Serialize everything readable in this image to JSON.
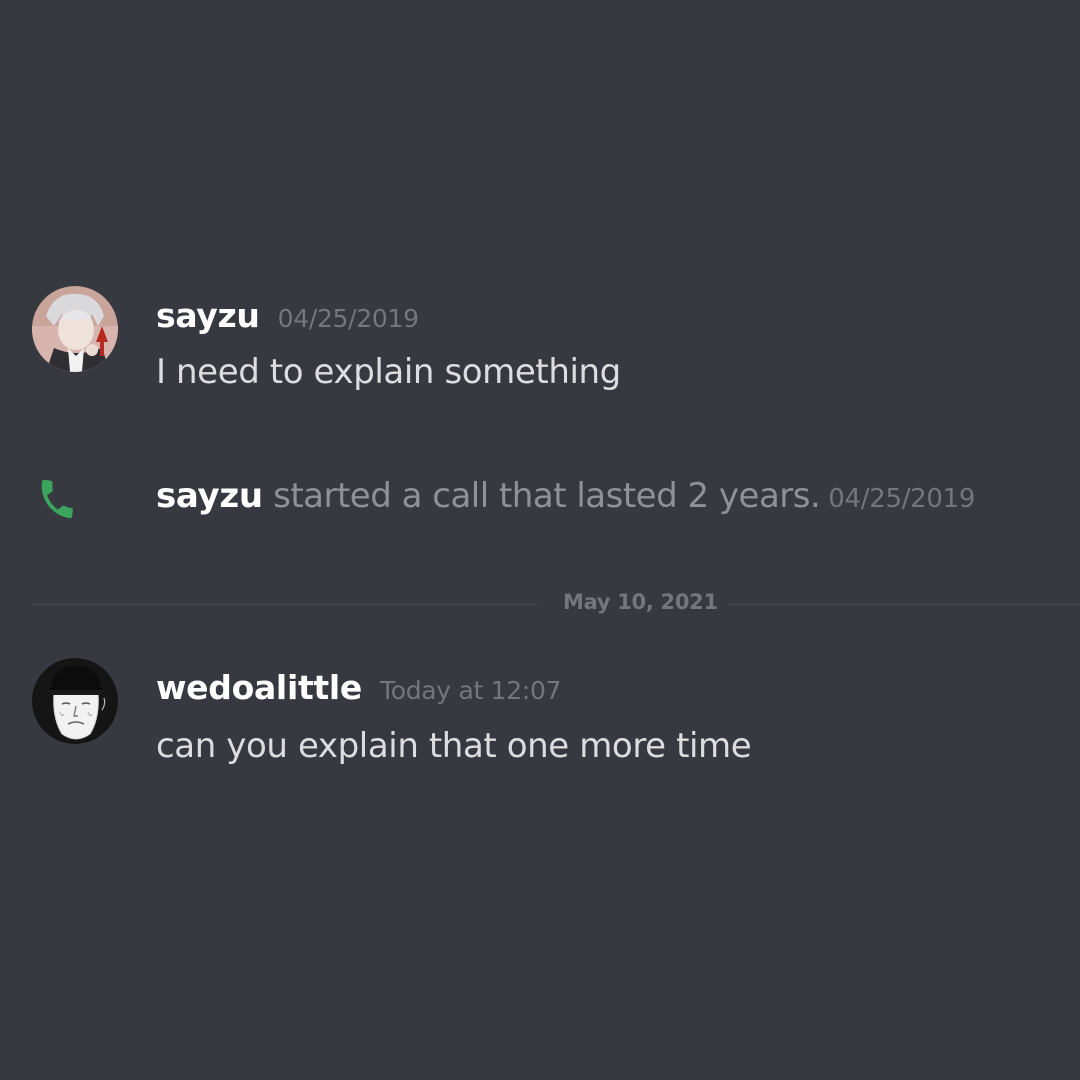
{
  "colors": {
    "background": "#36393f",
    "username": "#ffffff",
    "timestamp": "#72767d",
    "message_text": "#dcddde",
    "system_text": "#8e9297",
    "call_icon": "#3ba55d"
  },
  "messages": [
    {
      "username": "sayzu",
      "timestamp": "04/25/2019",
      "text": "I need to explain something",
      "avatar_icon": "anime-character-avatar"
    },
    {
      "username": "wedoalittle",
      "timestamp": "Today at 12:07",
      "text": "can you explain that one more time",
      "avatar_icon": "wojak-beanie-avatar"
    }
  ],
  "system_message": {
    "icon": "phone-icon",
    "username": "sayzu",
    "text": " started a call that lasted 2 years.",
    "timestamp": "04/25/2019"
  },
  "date_divider": {
    "label": "May 10, 2021"
  }
}
